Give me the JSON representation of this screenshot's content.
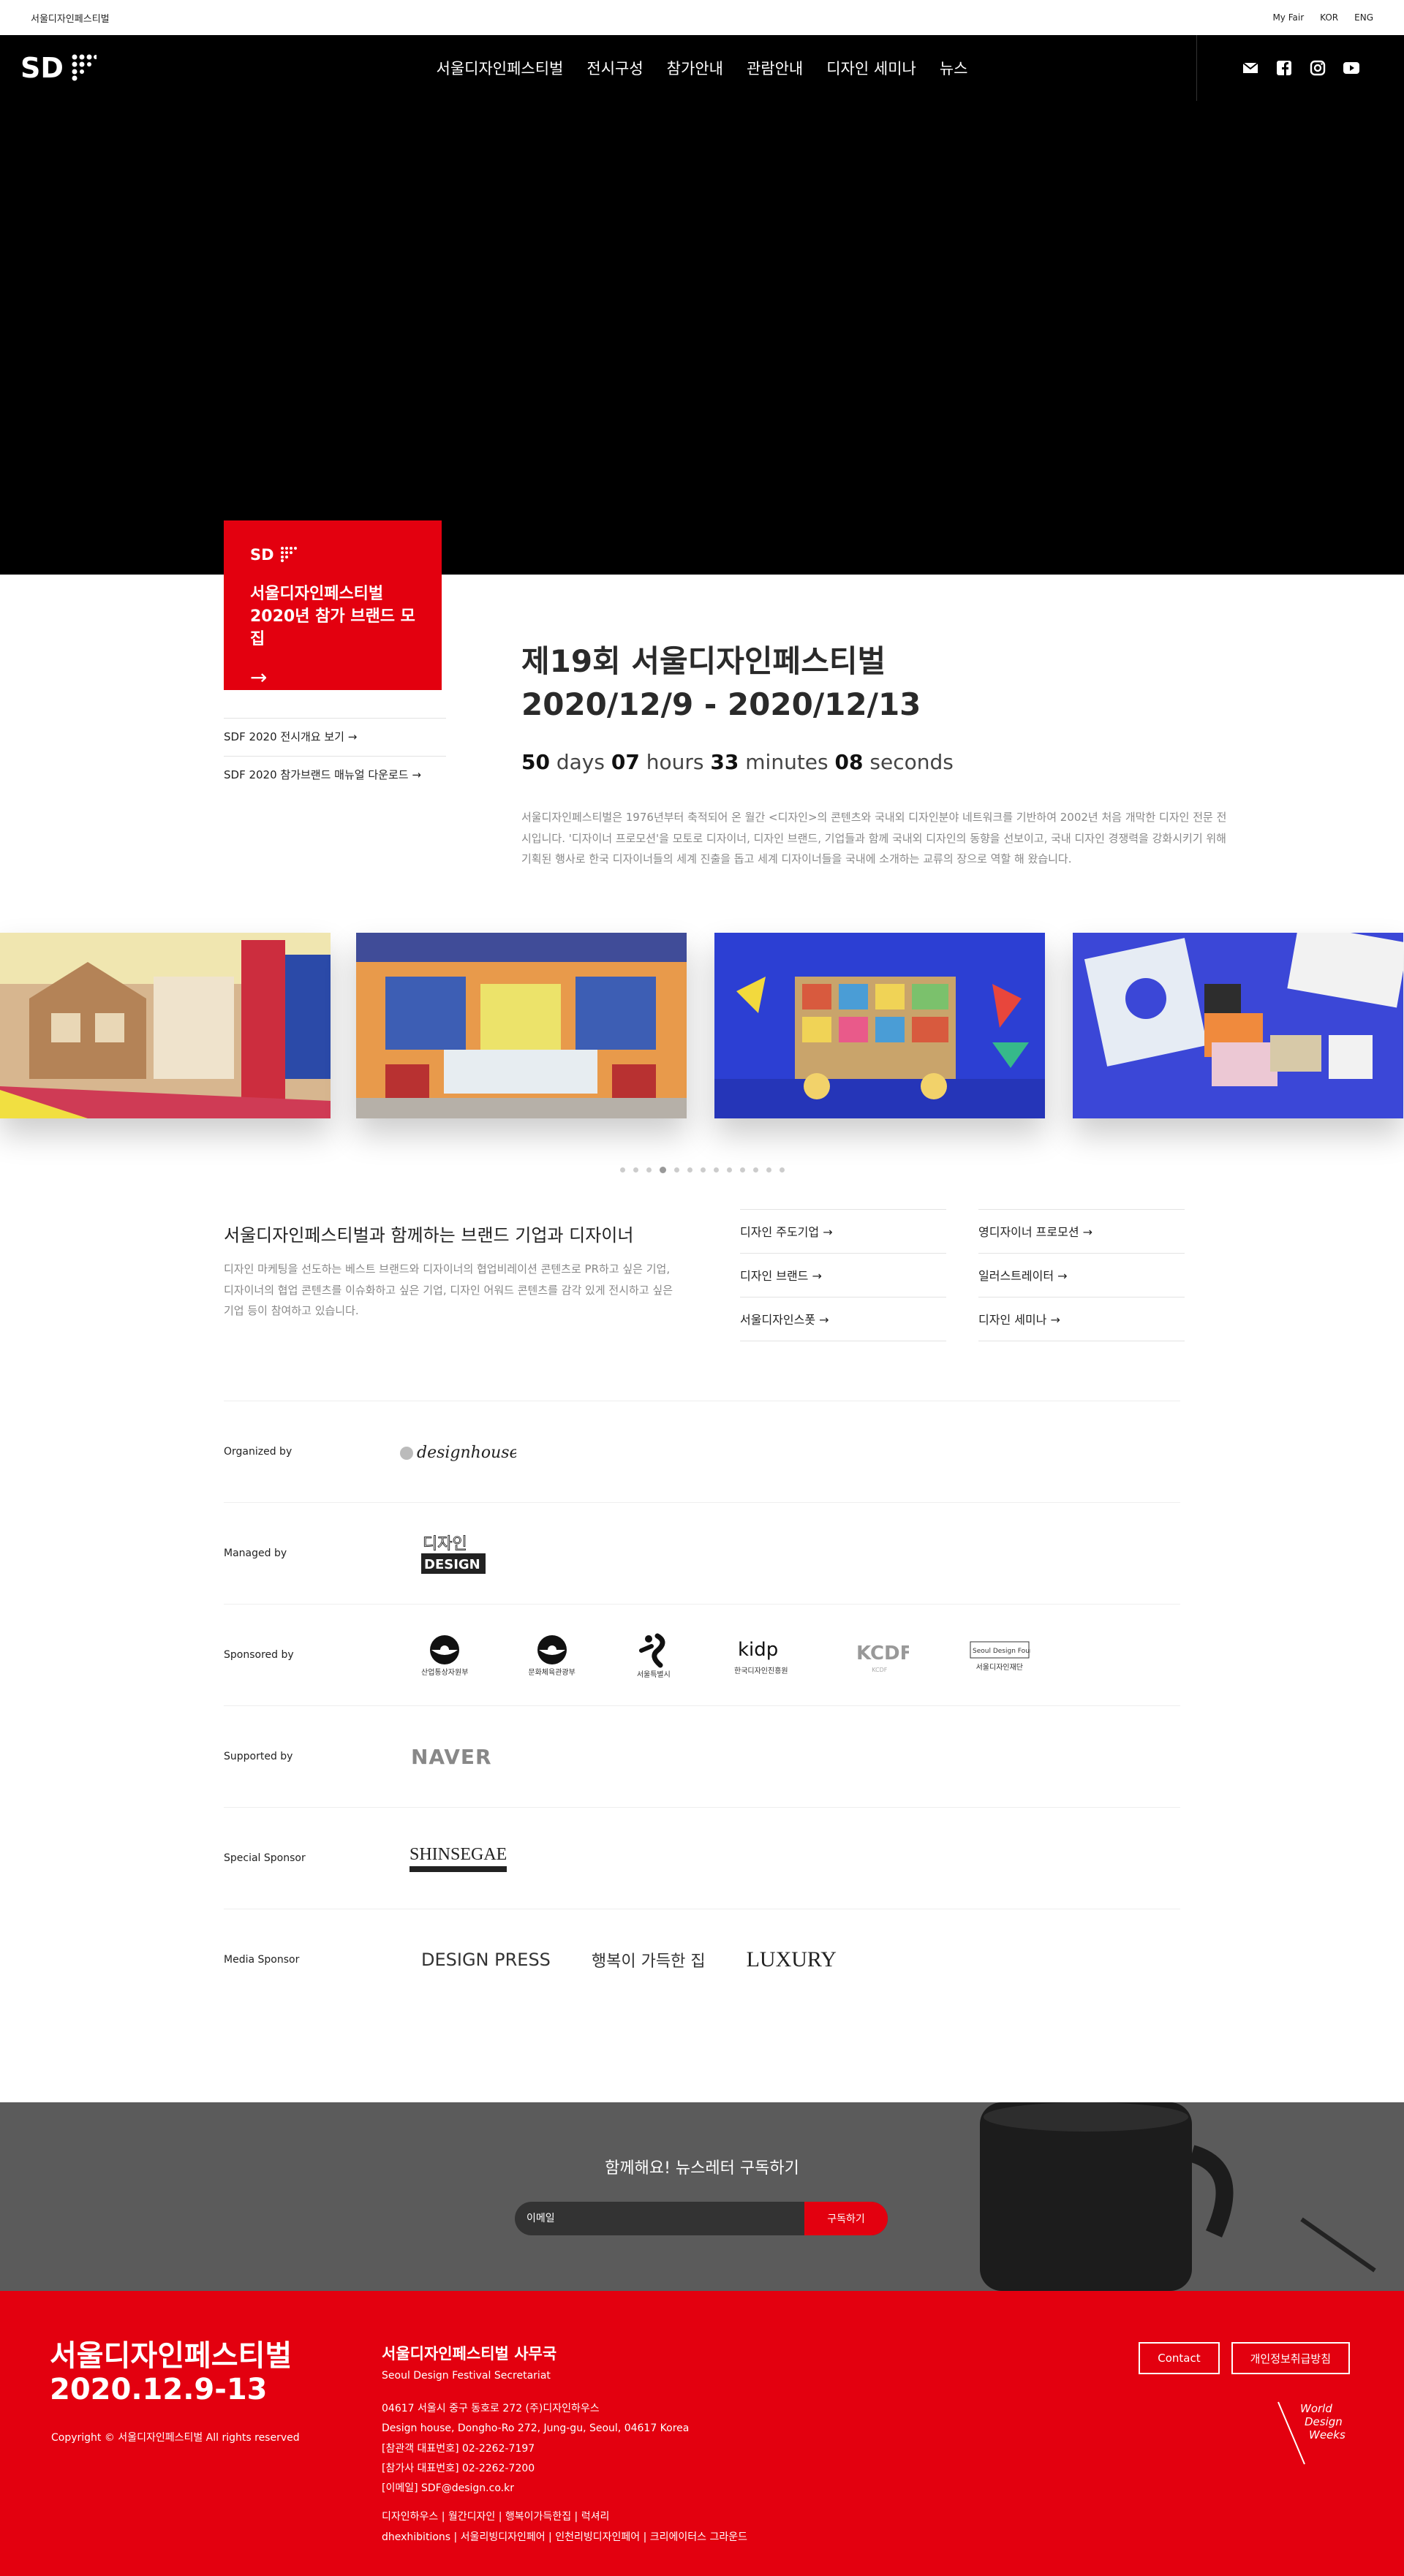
{
  "util": {
    "site_name": "서울디자인페스티벌",
    "links": [
      "My Fair",
      "KOR",
      "ENG"
    ]
  },
  "nav": {
    "logo_text": "SDF",
    "menu": [
      "서울디자인페스티벌",
      "전시구성",
      "참가안내",
      "관람안내",
      "디자인 세미나",
      "뉴스"
    ],
    "social": [
      "mail-icon",
      "facebook-icon",
      "instagram-icon",
      "youtube-icon"
    ]
  },
  "promo": {
    "mini_logo": "SDF",
    "title_line1": "서울디자인페스티벌",
    "title_line2": "2020년 참가 브랜드 모집",
    "arrow": "→"
  },
  "side_links": [
    "SDF 2020 전시개요 보기  →",
    "SDF 2020 참가브랜드 매뉴얼 다운로드  →"
  ],
  "event": {
    "title_line1": "제19회 서울디자인페스티벌",
    "title_line2": "2020/12/9 - 2020/12/13",
    "countdown": {
      "days": "50",
      "days_label": "days",
      "hours": "07",
      "hours_label": "hours",
      "minutes": "33",
      "minutes_label": "minutes",
      "seconds": "08",
      "seconds_label": "seconds"
    },
    "description": "서울디자인페스티벌은 1976년부터 축적되어 온 월간 <디자인>의 콘텐츠와 국내외 디자인분야 네트워크를 기반하여 2002년 처음 개막한 디자인 전문 전시입니다. '디자이너 프로모션'을 모토로 디자이너, 디자인 브랜드, 기업들과 함께 국내외 디자인의 동향을 선보이고, 국내 디자인 경쟁력을 강화시키기 위해 기획된 행사로 한국 디자이너들의 세계 진출을 돕고 세계 디자이너들을 국내에 소개하는 교류의 장으로 역할 해 왔습니다."
  },
  "carousel": {
    "slides": 4,
    "dot_count": 13,
    "active_dot": 3
  },
  "brand": {
    "heading": "서울디자인페스티벌과 함께하는 브랜드 기업과 디자이너",
    "description": "디자인 마케팅을 선도하는 베스트 브랜드와 디자이너의 협업비레이션 콘텐츠로 PR하고 싶은 기업, 디자이너의 협업 콘텐츠를 이슈화하고 싶은 기업, 디자인 어워드 콘텐츠를 감각 있게 전시하고 싶은 기업 등이 참여하고 있습니다.",
    "links_col1": [
      "디자인 주도기업  →",
      "디자인 브랜드  →",
      "서울디자인스폿  →"
    ],
    "links_col2": [
      "영디자이너 프로모션  →",
      "일러스트레이터  →",
      "디자인 세미나  →"
    ]
  },
  "sponsors": {
    "rows": [
      {
        "label": "Organized by"
      },
      {
        "label": "Managed by"
      },
      {
        "label": "Sponsored by"
      },
      {
        "label": "Supported by"
      },
      {
        "label": "Special Sponsor"
      },
      {
        "label": "Media Sponsor"
      }
    ],
    "organized_logo": "designhouse",
    "managed_logo_top": "디자인",
    "managed_logo_bottom": "DESIGN",
    "sponsored": [
      "산업통상자원부",
      "문화체육관광부",
      "서울특별시",
      "한국디자인진흥원",
      "KCDF",
      "서울디자인재단"
    ],
    "kidp_text": "kidp",
    "kcdf_text": "KCDF",
    "sdf_top": "Seoul Design Foundation",
    "supported_logo": "NAVER",
    "special_logo": "SHINSEGAE",
    "media": [
      "DESIGN PRESS",
      "행복이 가득한 집",
      "LUXURY"
    ]
  },
  "newsletter": {
    "heading": "함께해요! 뉴스레터 구독하기",
    "placeholder": "이메일",
    "button": "구독하기"
  },
  "footer": {
    "title_line1": "서울디자인페스티벌",
    "title_line2": "2020.12.9-13",
    "copyright": "Copyright © 서울디자인페스티벌 All rights reserved",
    "office_title": "서울디자인페스티벌 사무국",
    "office_sub": "Seoul Design Festival Secretariat",
    "addr_lines": [
      "04617 서울시 중구 동호로 272 (주)디자인하우스",
      "Design house, Dongho-Ro 272, Jung-gu, Seoul, 04617 Korea",
      "[참관객 대표번호] 02-2262-7197",
      "[참가사 대표번호] 02-2262-7200",
      "[이메일] SDF@design.co.kr"
    ],
    "link_lines": [
      "디자인하우스 | 월간디자인 | 행복이가득한집 | 럭셔리",
      "dhexhibitions | 서울리빙디자인페어 | 인천리빙디자인페어 | 크리에이터스 그라운드"
    ],
    "buttons": [
      "Contact",
      "개인정보취급방침"
    ],
    "wdw": [
      "World",
      "Design",
      "Weeks"
    ]
  }
}
